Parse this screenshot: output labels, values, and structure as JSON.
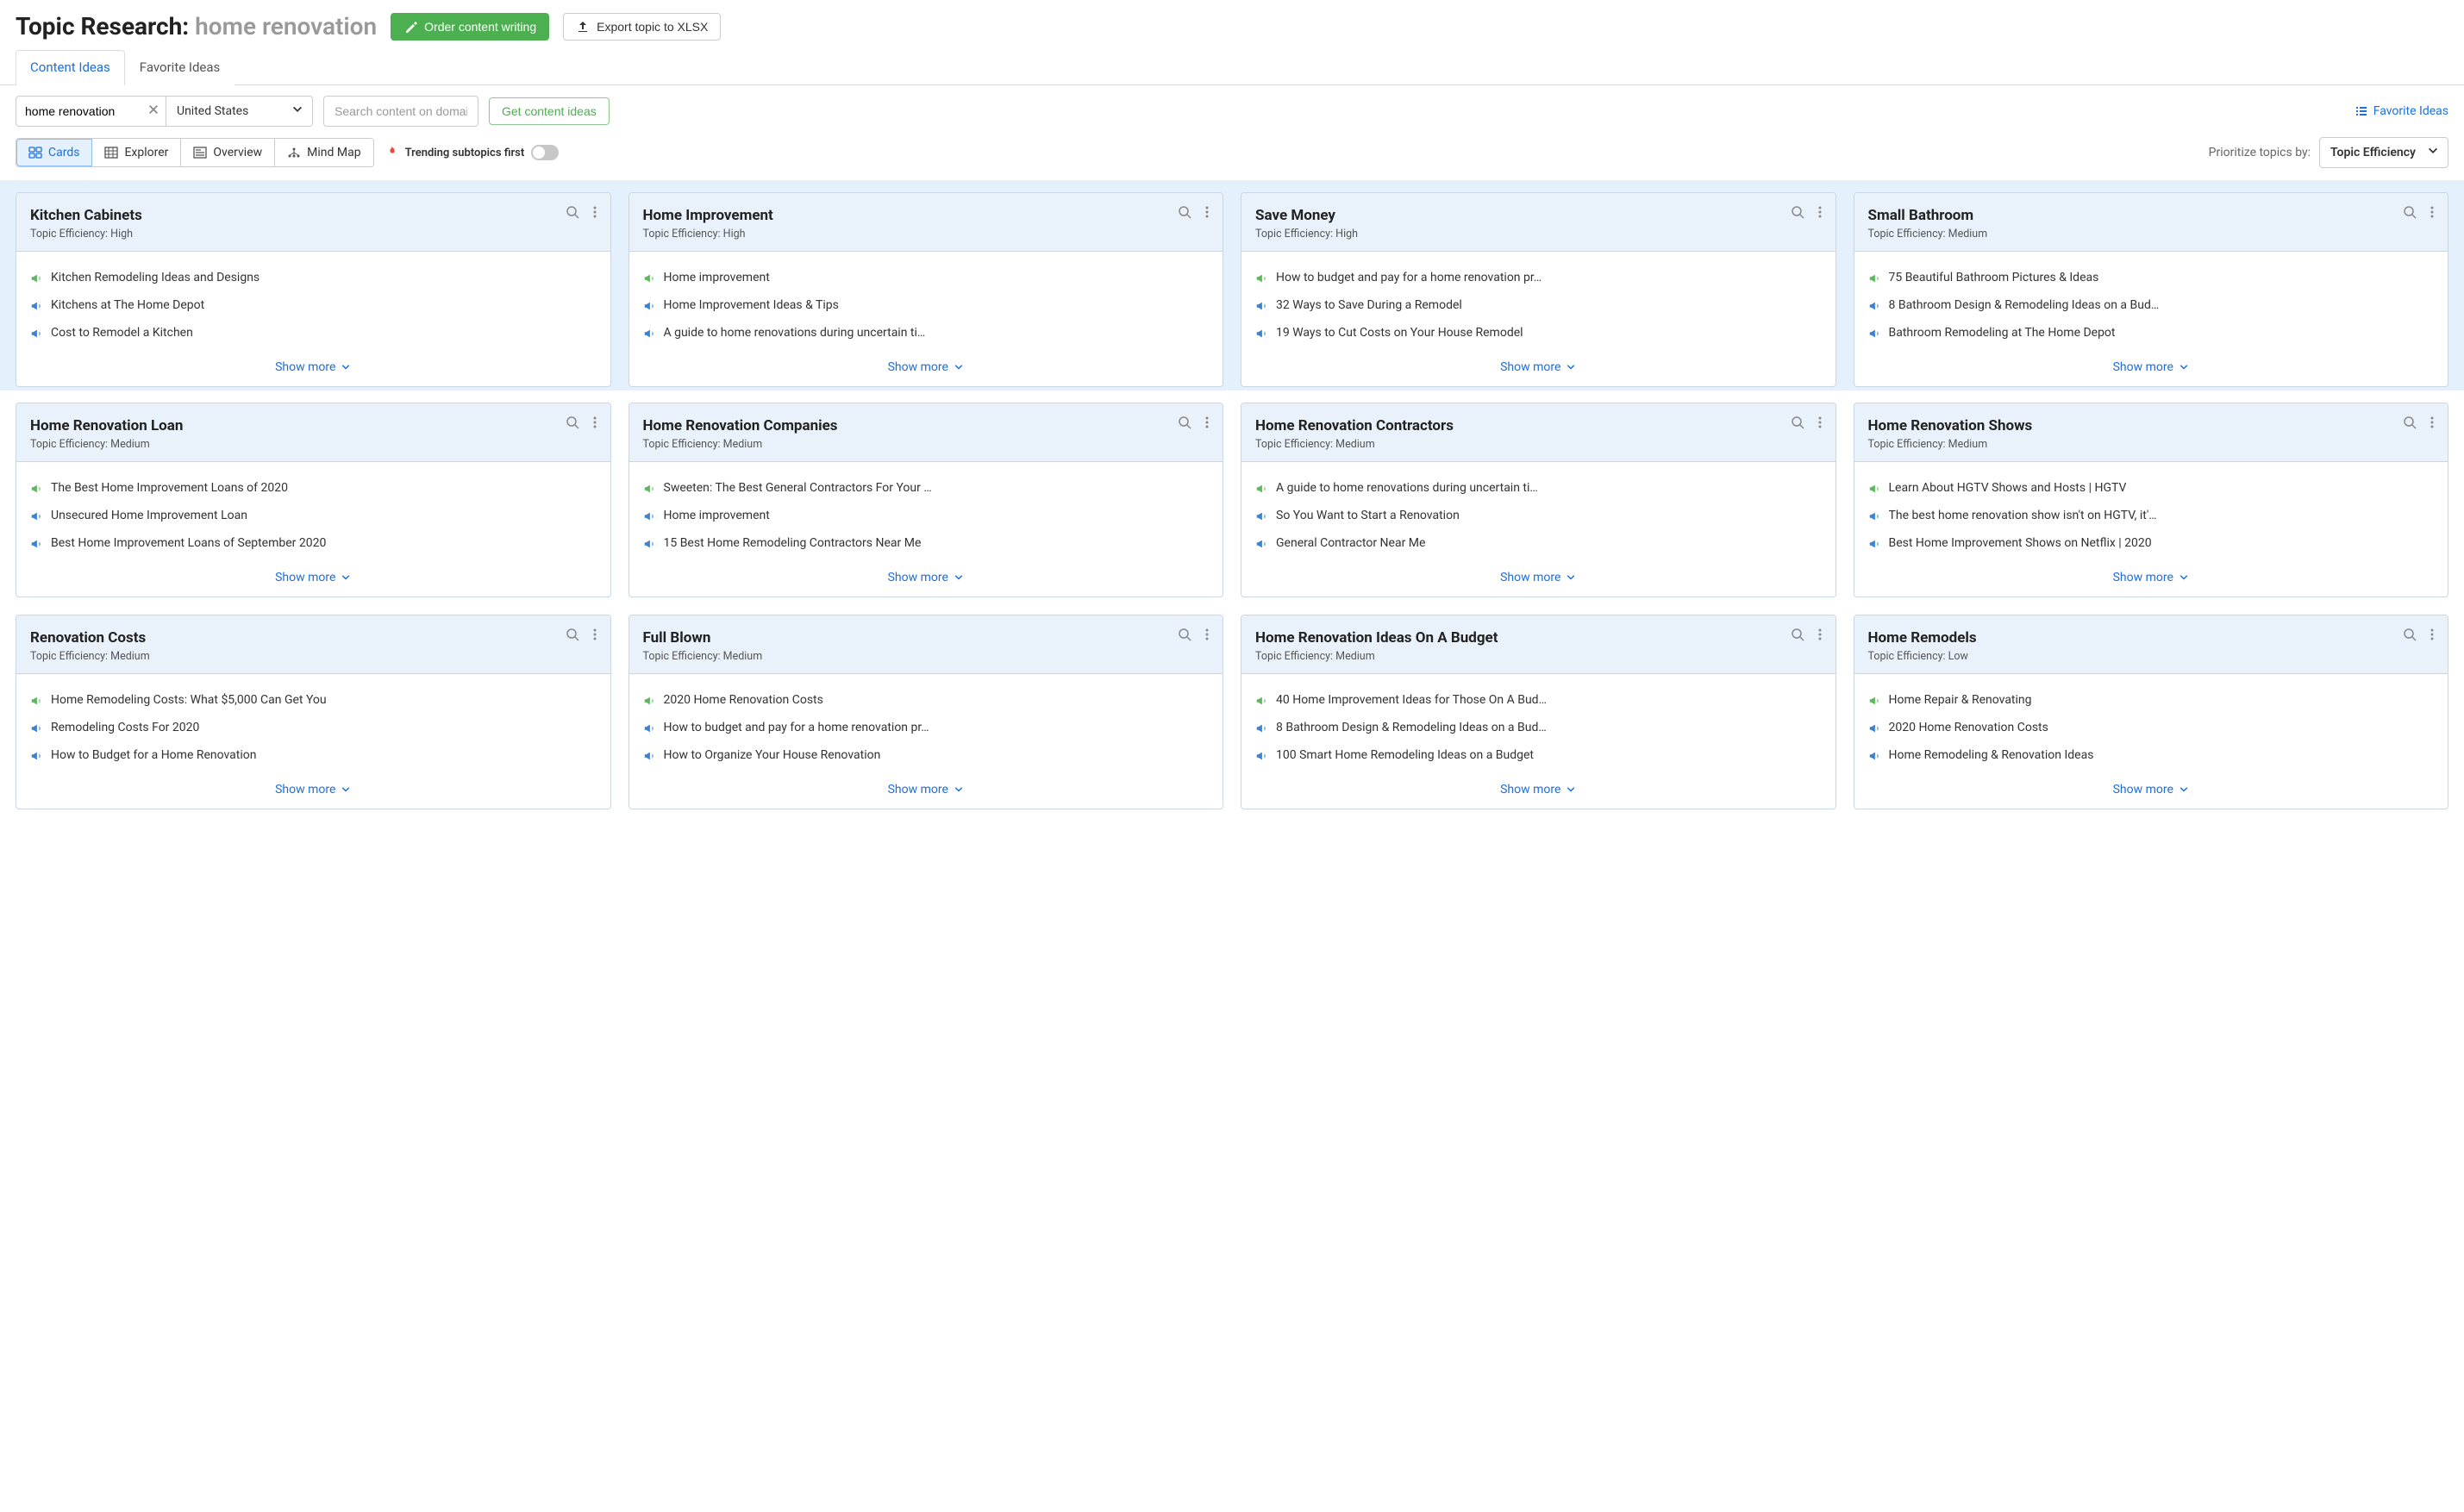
{
  "header": {
    "title_prefix": "Topic Research: ",
    "query": "home renovation",
    "order_btn": "Order content writing",
    "export_btn": "Export topic to XLSX"
  },
  "tabs": {
    "content_ideas": "Content Ideas",
    "favorite_ideas": "Favorite Ideas"
  },
  "toolbar": {
    "topic_value": "home renovation",
    "country": "United States",
    "domain_placeholder": "Search content on domain",
    "get_ideas": "Get content ideas",
    "favorite_link": "Favorite Ideas"
  },
  "views": {
    "cards": "Cards",
    "explorer": "Explorer",
    "overview": "Overview",
    "mindmap": "Mind Map",
    "trending_label": "Trending subtopics first",
    "prioritize_label": "Prioritize topics by:",
    "prioritize_value": "Topic Efficiency"
  },
  "common": {
    "topic_eff_label": "Topic Efficiency:  ",
    "show_more": "Show more"
  },
  "cards_top": [
    {
      "title": "Kitchen Cabinets",
      "efficiency": "High",
      "items": [
        {
          "icon": "green",
          "text": "Kitchen Remodeling Ideas and Designs"
        },
        {
          "icon": "blue",
          "text": "Kitchens at The Home Depot"
        },
        {
          "icon": "blue",
          "text": "Cost to Remodel a Kitchen"
        }
      ]
    },
    {
      "title": "Home Improvement",
      "efficiency": "High",
      "items": [
        {
          "icon": "green",
          "text": "Home improvement"
        },
        {
          "icon": "blue",
          "text": "Home Improvement Ideas & Tips"
        },
        {
          "icon": "blue",
          "text": "A guide to home renovations during uncertain ti…"
        }
      ]
    },
    {
      "title": "Save Money",
      "efficiency": "High",
      "items": [
        {
          "icon": "green",
          "text": "How to budget and pay for a home renovation pr…"
        },
        {
          "icon": "blue",
          "text": "32 Ways to Save During a Remodel"
        },
        {
          "icon": "blue",
          "text": "19 Ways to Cut Costs on Your House Remodel"
        }
      ]
    },
    {
      "title": "Small Bathroom",
      "efficiency": "Medium",
      "items": [
        {
          "icon": "green",
          "text": "75 Beautiful Bathroom Pictures & Ideas"
        },
        {
          "icon": "blue",
          "text": "8 Bathroom Design & Remodeling Ideas on a Bud…"
        },
        {
          "icon": "blue",
          "text": "Bathroom Remodeling at The Home Depot"
        }
      ]
    }
  ],
  "cards_bottom": [
    {
      "title": "Home Renovation Loan",
      "efficiency": "Medium",
      "items": [
        {
          "icon": "green",
          "text": "The Best Home Improvement Loans of 2020"
        },
        {
          "icon": "blue",
          "text": "Unsecured Home Improvement Loan"
        },
        {
          "icon": "blue",
          "text": "Best Home Improvement Loans of September 2020"
        }
      ]
    },
    {
      "title": "Home Renovation Companies",
      "efficiency": "Medium",
      "items": [
        {
          "icon": "green",
          "text": "Sweeten: The Best General Contractors For Your …"
        },
        {
          "icon": "blue",
          "text": "Home improvement"
        },
        {
          "icon": "blue",
          "text": "15 Best Home Remodeling Contractors Near Me"
        }
      ]
    },
    {
      "title": "Home Renovation Contractors",
      "efficiency": "Medium",
      "items": [
        {
          "icon": "green",
          "text": "A guide to home renovations during uncertain ti…"
        },
        {
          "icon": "blue",
          "text": "So You Want to Start a Renovation"
        },
        {
          "icon": "blue",
          "text": "General Contractor Near Me"
        }
      ]
    },
    {
      "title": "Home Renovation Shows",
      "efficiency": "Medium",
      "items": [
        {
          "icon": "green",
          "text": "Learn About HGTV Shows and Hosts | HGTV"
        },
        {
          "icon": "blue",
          "text": "The best home renovation show isn't on HGTV, it'…"
        },
        {
          "icon": "blue",
          "text": "Best Home Improvement Shows on Netflix | 2020"
        }
      ]
    },
    {
      "title": "Renovation Costs",
      "efficiency": "Medium",
      "items": [
        {
          "icon": "green",
          "text": "Home Remodeling Costs: What $5,000 Can Get You"
        },
        {
          "icon": "blue",
          "text": "Remodeling Costs For 2020"
        },
        {
          "icon": "blue",
          "text": "How to Budget for a Home Renovation"
        }
      ]
    },
    {
      "title": "Full Blown",
      "efficiency": "Medium",
      "items": [
        {
          "icon": "green",
          "text": "2020 Home Renovation Costs"
        },
        {
          "icon": "blue",
          "text": "How to budget and pay for a home renovation pr…"
        },
        {
          "icon": "blue",
          "text": "How to Organize Your House Renovation"
        }
      ]
    },
    {
      "title": "Home Renovation Ideas On A Budget",
      "efficiency": "Medium",
      "items": [
        {
          "icon": "green",
          "text": "40 Home Improvement Ideas for Those On A Bud…"
        },
        {
          "icon": "blue",
          "text": "8 Bathroom Design & Remodeling Ideas on a Bud…"
        },
        {
          "icon": "blue",
          "text": "100 Smart Home Remodeling Ideas on a Budget"
        }
      ]
    },
    {
      "title": "Home Remodels",
      "efficiency": "Low",
      "items": [
        {
          "icon": "green",
          "text": "Home Repair & Renovating"
        },
        {
          "icon": "blue",
          "text": "2020 Home Renovation Costs"
        },
        {
          "icon": "blue",
          "text": "Home Remodeling & Renovation Ideas"
        }
      ]
    }
  ]
}
